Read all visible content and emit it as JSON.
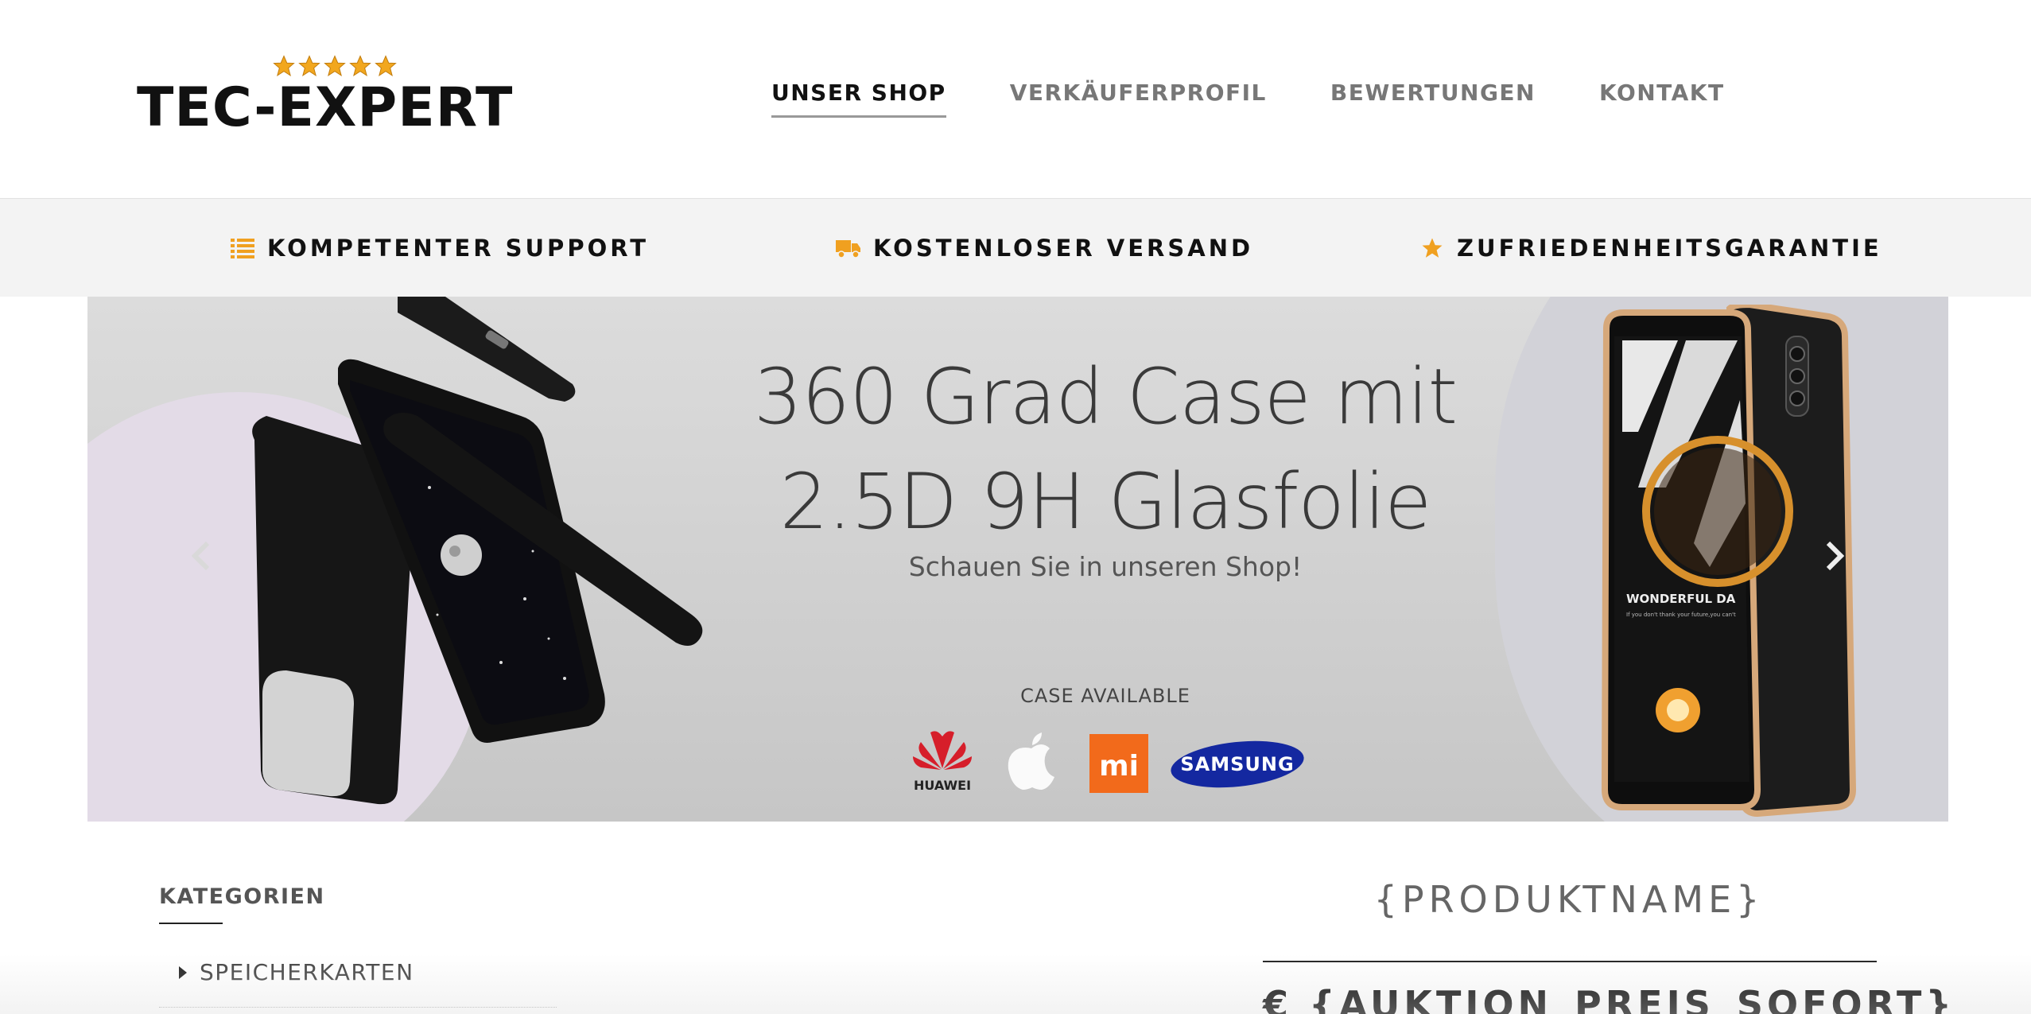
{
  "header": {
    "logo_text": "TEC-EXPERT",
    "logo_stars": 5,
    "nav": [
      {
        "label": "UNSER SHOP",
        "active": true
      },
      {
        "label": "VERKÄUFERPROFIL",
        "active": false
      },
      {
        "label": "BEWERTUNGEN",
        "active": false
      },
      {
        "label": "KONTAKT",
        "active": false
      }
    ]
  },
  "features": [
    {
      "icon": "list-icon",
      "label": "KOMPETENTER SUPPORT"
    },
    {
      "icon": "truck-icon",
      "label": "KOSTENLOSER VERSAND"
    },
    {
      "icon": "star-icon",
      "label": "ZUFRIEDENHEITSGARANTIE"
    }
  ],
  "slider": {
    "title_line1": "360 Grad Case mit",
    "title_line2": "2.5D 9H Glasfolie",
    "subtitle": "Schauen Sie in unseren Shop!",
    "case_available": "CASE AVAILABLE",
    "brands": {
      "huawei": "HUAWEI",
      "apple": "apple-logo-icon",
      "xiaomi": "mi",
      "samsung": "SAMSUNG"
    },
    "phone_screen_text": "WONDERFUL DA",
    "phone_screen_small": "If you don't thank your future,you can't"
  },
  "sidebar": {
    "title": "KATEGORIEN",
    "items": [
      {
        "label": "SPEICHERKARTEN"
      }
    ]
  },
  "product": {
    "name": "{PRODUKTNAME}",
    "price": "€ {AUKTION_PREIS_SOFORT}"
  },
  "colors": {
    "accent": "#f0a020",
    "nav_active": "#111111",
    "nav_inactive": "#777777",
    "feature_bar_bg": "#f3f3f3",
    "xiaomi_orange": "#f26a1b",
    "samsung_blue": "#1428a0",
    "huawei_red": "#d61e2a"
  }
}
